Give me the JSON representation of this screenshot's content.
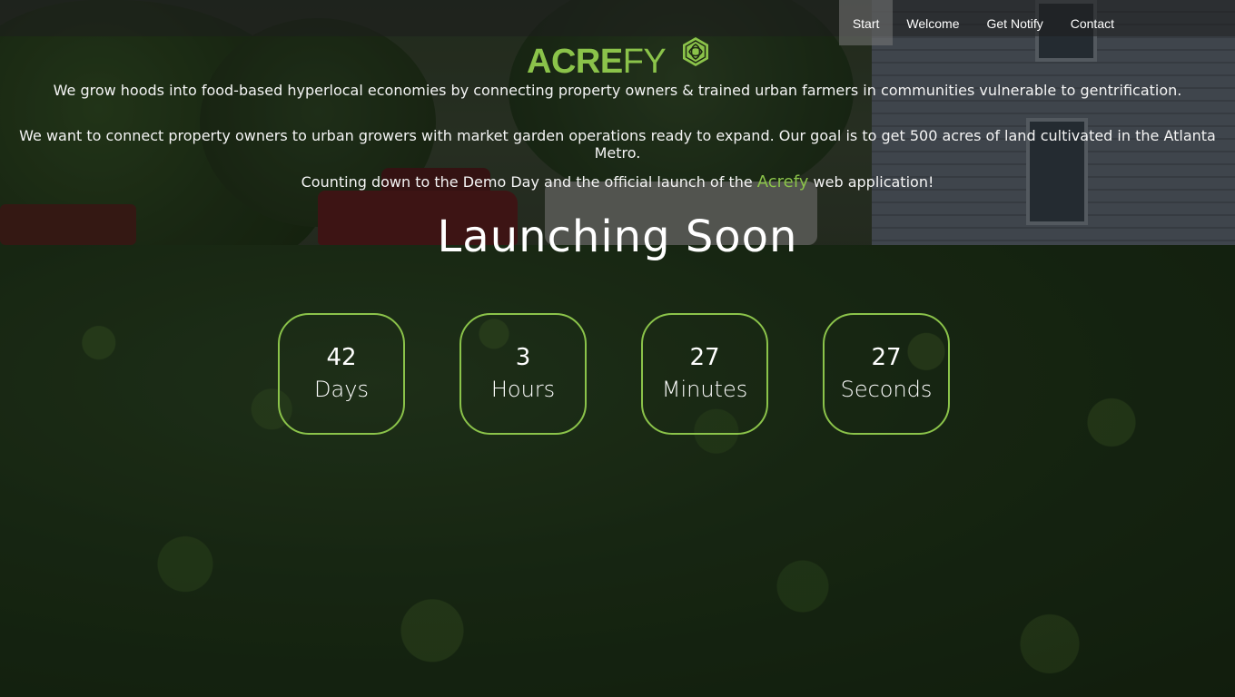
{
  "nav": {
    "items": [
      {
        "label": "Start",
        "active": true
      },
      {
        "label": "Welcome",
        "active": false
      },
      {
        "label": "Get Notify",
        "active": false
      },
      {
        "label": "Contact",
        "active": false
      }
    ]
  },
  "logo": {
    "text_bold": "ACRE",
    "text_light": "FY",
    "color": "#8bc34a",
    "icon": "leaf-badge-icon"
  },
  "intro": {
    "p1": "We grow hoods into food-based hyperlocal economies by connecting property owners & trained urban farmers in communities vulnerable to gentrification.",
    "p2": "We want to connect property owners to urban growers with market garden operations ready to expand. Our goal is to get 500 acres of land cultivated in the Atlanta Metro.",
    "p3_before": "Counting down to the Demo Day and the official launch of the ",
    "p3_brand": "Acrefy",
    "p3_after": " web application!"
  },
  "headline": "Launching Soon",
  "countdown": [
    {
      "value": "42",
      "label": "Days"
    },
    {
      "value": "3",
      "label": "Hours"
    },
    {
      "value": "27",
      "label": "Minutes"
    },
    {
      "value": "27",
      "label": "Seconds"
    }
  ],
  "colors": {
    "accent": "#8bc34a",
    "text": "#ffffff"
  }
}
